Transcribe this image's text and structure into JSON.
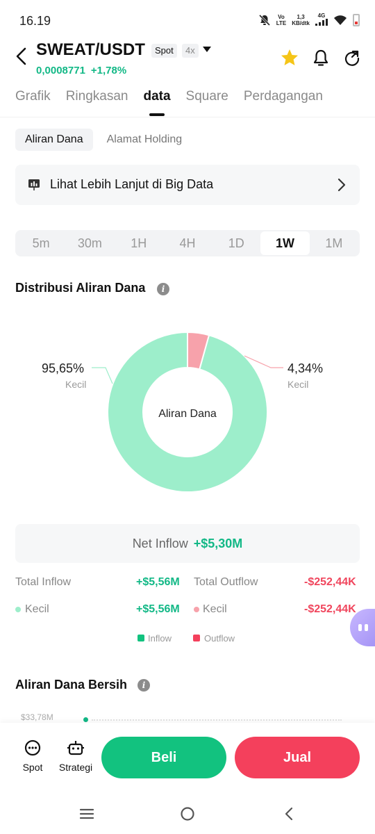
{
  "status_bar": {
    "time": "16.19",
    "net_left_top": "Vo",
    "net_left_sub": "LTE",
    "speed_top": "1,3",
    "speed_sub": "KB/dtk",
    "gen": "4G"
  },
  "header": {
    "pair": "SWEAT/USDT",
    "market_badge": "Spot",
    "leverage_badge": "4x",
    "price": "0,0008771",
    "change": "+1,78%"
  },
  "main_tabs": [
    {
      "label": "Grafik",
      "active": false
    },
    {
      "label": "Ringkasan",
      "active": false
    },
    {
      "label": "data",
      "active": true
    },
    {
      "label": "Square",
      "active": false
    },
    {
      "label": "Perdagangan",
      "active": false
    }
  ],
  "sub_tabs": [
    {
      "label": "Aliran Dana",
      "active": true
    },
    {
      "label": "Alamat Holding",
      "active": false
    }
  ],
  "banner": {
    "text": "Lihat Lebih Lanjut di Big Data"
  },
  "timeframes": [
    {
      "label": "5m",
      "active": false
    },
    {
      "label": "30m",
      "active": false
    },
    {
      "label": "1H",
      "active": false
    },
    {
      "label": "4H",
      "active": false
    },
    {
      "label": "1D",
      "active": false
    },
    {
      "label": "1W",
      "active": true
    },
    {
      "label": "1M",
      "active": false
    }
  ],
  "distribution": {
    "title": "Distribusi Aliran Dana",
    "info_icon": "info-icon"
  },
  "chart_data": {
    "type": "pie",
    "center_label": "Aliran Dana",
    "slices": [
      {
        "label": "Kecil",
        "value": 95.65,
        "display": "95,65%",
        "color": "#9deecb"
      },
      {
        "label": "Kecil",
        "value": 4.34,
        "display": "4,34%",
        "color": "#f7a2ab"
      }
    ]
  },
  "net_inflow": {
    "label": "Net Inflow",
    "value": "+$5,30M"
  },
  "summary": {
    "total_inflow_label": "Total Inflow",
    "total_inflow_value": "+$5,56M",
    "total_outflow_label": "Total Outflow",
    "total_outflow_value": "-$252,44K",
    "small_in_label": "Kecil",
    "small_in_value": "+$5,56M",
    "small_out_label": "Kecil",
    "small_out_value": "-$252,44K"
  },
  "legend": {
    "inflow": "Inflow",
    "outflow": "Outflow",
    "inflow_color": "#12c27f",
    "outflow_color": "#f4405c"
  },
  "net_flow": {
    "title": "Aliran Dana Bersih",
    "first_tick": "$33,78M"
  },
  "bottom_bar": {
    "spot_label": "Spot",
    "strategy_label": "Strategi",
    "buy_label": "Beli",
    "sell_label": "Jual"
  }
}
